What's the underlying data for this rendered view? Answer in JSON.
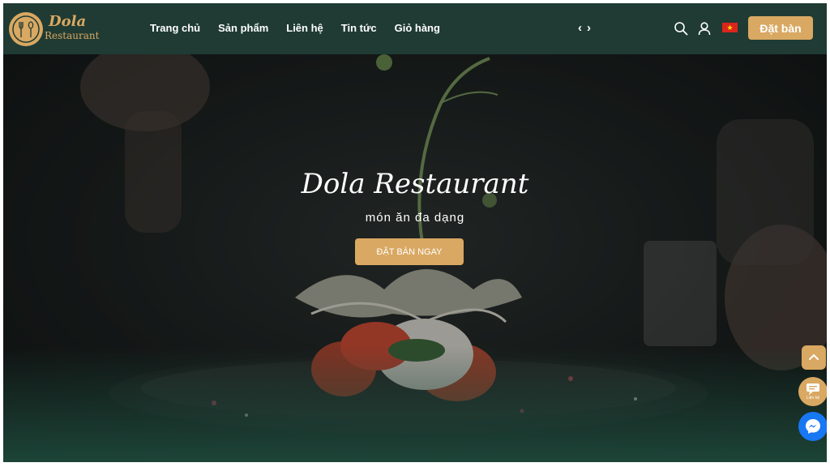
{
  "brand": {
    "line1": "Dola",
    "line2": "Restaurant",
    "logo_icon": "fork-spoon-plate-icon",
    "colors": {
      "header_bg": "#1f3b33",
      "accent": "#d9a862"
    }
  },
  "nav": {
    "items": [
      "Trang chủ",
      "Sản phẩm",
      "Liên hệ",
      "Tin tức",
      "Giỏ hàng"
    ],
    "prev_arrow": "‹",
    "next_arrow": "›"
  },
  "header_actions": {
    "search_icon": "search-icon",
    "account_icon": "user-icon",
    "language_flag": "vietnam-flag-icon",
    "flag_star": "★",
    "book_label": "Đặt bàn"
  },
  "hero": {
    "title": "Dola Restaurant",
    "subtitle": "món ăn đa dạng",
    "cta_label": "ĐẶT BÀN NGAY"
  },
  "floating": {
    "scroll_top_icon": "chevron-up-icon",
    "contact_icon": "chat-bubble-icon",
    "contact_label": "Liên hệ",
    "messenger_icon": "messenger-icon"
  }
}
